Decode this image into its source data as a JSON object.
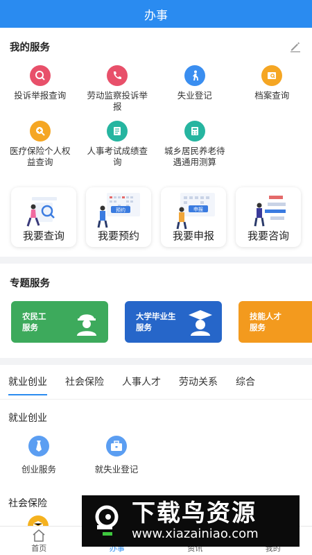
{
  "header": {
    "title": "办事"
  },
  "my_services": {
    "title": "我的服务",
    "items": [
      {
        "label": "投诉举报查询",
        "icon": "search-icon",
        "color": "#e8506a"
      },
      {
        "label": "劳动监察投诉举报",
        "icon": "phone-icon",
        "color": "#e8506a"
      },
      {
        "label": "失业登记",
        "icon": "walking-person-icon",
        "color": "#3a8ef0"
      },
      {
        "label": "档案查询",
        "icon": "file-search-icon",
        "color": "#f5a623"
      },
      {
        "label": "医疗保险个人权益查询",
        "icon": "medical-search-icon",
        "color": "#f5a623"
      },
      {
        "label": "人事考试成绩查询",
        "icon": "exam-icon",
        "color": "#26b5a0"
      },
      {
        "label": "城乡居民养老待遇通用测算",
        "icon": "calculator-icon",
        "color": "#26b5a0"
      }
    ]
  },
  "quick_actions": [
    {
      "label": "我要查询"
    },
    {
      "label": "我要预约",
      "chip": "预约"
    },
    {
      "label": "我要申报",
      "chip": "申报"
    },
    {
      "label": "我要咨询"
    }
  ],
  "topics": {
    "title": "专题服务",
    "cards": [
      {
        "line1": "农民工",
        "line2": "服务",
        "color": "#3daa5c"
      },
      {
        "line1": "大学毕业生",
        "line2": "服务",
        "color": "#2666c9"
      },
      {
        "line1": "技能人才",
        "line2": "服务",
        "color": "#f39a1e"
      }
    ]
  },
  "tabs": [
    {
      "label": "就业创业",
      "active": true
    },
    {
      "label": "社会保险"
    },
    {
      "label": "人事人才"
    },
    {
      "label": "劳动关系"
    },
    {
      "label": "综合"
    }
  ],
  "categories": [
    {
      "title": "就业创业",
      "items": [
        {
          "label": "创业服务"
        },
        {
          "label": "就失业登记"
        }
      ]
    },
    {
      "title": "社会保险"
    }
  ],
  "bottom_nav": [
    {
      "label": "首页"
    },
    {
      "label": "办事",
      "active": true
    },
    {
      "label": "资讯"
    },
    {
      "label": "我的"
    }
  ],
  "watermark": {
    "title": "下载鸟资源",
    "url": "www.xiazainiao.com"
  }
}
